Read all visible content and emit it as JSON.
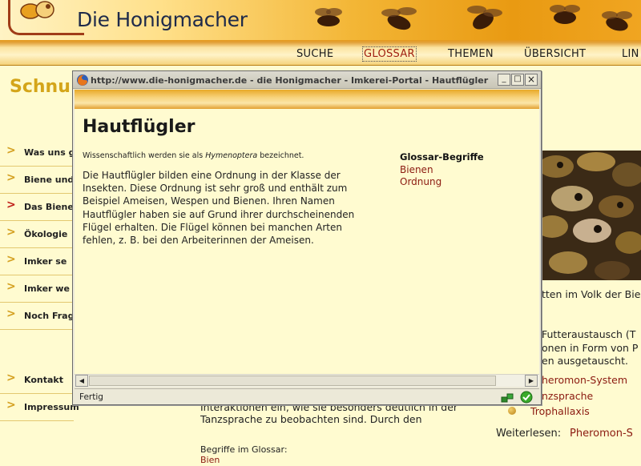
{
  "site": {
    "title": "Die Honigmacher",
    "page_heading": "Schnu",
    "nav": [
      {
        "label": "SUCHE",
        "active": false
      },
      {
        "label": "GLOSSAR",
        "active": true
      },
      {
        "label": "THEMEN",
        "active": false
      },
      {
        "label": "ÜBERSICHT",
        "active": false
      },
      {
        "label": "LIN",
        "active": false
      }
    ],
    "side_menu": [
      {
        "label": "Was uns g",
        "active": false
      },
      {
        "label": "Biene und",
        "active": false
      },
      {
        "label": "Das Biene",
        "active": true
      },
      {
        "label": "Ökologie",
        "active": false
      },
      {
        "label": "Imker se",
        "active": false
      },
      {
        "label": "Imker we",
        "active": false
      },
      {
        "label": "Noch Frag",
        "active": false
      },
      {
        "label": "Kontakt",
        "active": false
      },
      {
        "label": "Impressum",
        "active": false
      }
    ],
    "right_text": {
      "line1": "tten im Volk der Bie",
      "line2": "Futteraustausch (T",
      "line3": "onen in Form von P",
      "line4": "en ausgetauscht."
    },
    "right_links": [
      "heromon-System",
      "nzsprache",
      "Trophallaxis"
    ],
    "weiterlesen_label": "Weiterlesen:",
    "weiterlesen_link": "Pheromon-S",
    "bottom_text": {
      "line1": "Interaktionen ein, wie sie besonders deutlich in der",
      "line2": "Tanzsprache zu beobachten sind. Durch den",
      "glossar_label": "Begriffe im Glossar:",
      "glossar_link": "Bien"
    }
  },
  "popup": {
    "window_title": "http://www.die-honigmacher.de - die Honigmacher - Imkerei-Portal - Hautflügler - Glos...",
    "heading": "Hautflügler",
    "sci_prefix": "Wissenschaftlich werden sie als ",
    "sci_name": "Hymenoptera",
    "sci_suffix": " bezeichnet.",
    "body": "Die Hautflügler bilden eine Ordnung in der Klasse der Insekten. Diese Ordnung ist sehr groß und enthält zum Beispiel Ameisen, Wespen und Bienen. Ihren Namen Hautflügler haben sie auf Grund ihrer durchscheinenden Flügel erhalten. Die Flügel können bei manchen Arten fehlen, z. B. bei den Arbeiterinnen der Ameisen.",
    "glossar_heading": "Glossar-Begriffe",
    "glossar_links": [
      "Bienen",
      "Ordnung"
    ],
    "status": "Fertig",
    "buttons": {
      "minimize": "_",
      "maximize": "□",
      "close": "×"
    }
  },
  "colors": {
    "accent_gold": "#d4a51a",
    "link_red": "#8b1a10",
    "background": "#fffbd0"
  }
}
